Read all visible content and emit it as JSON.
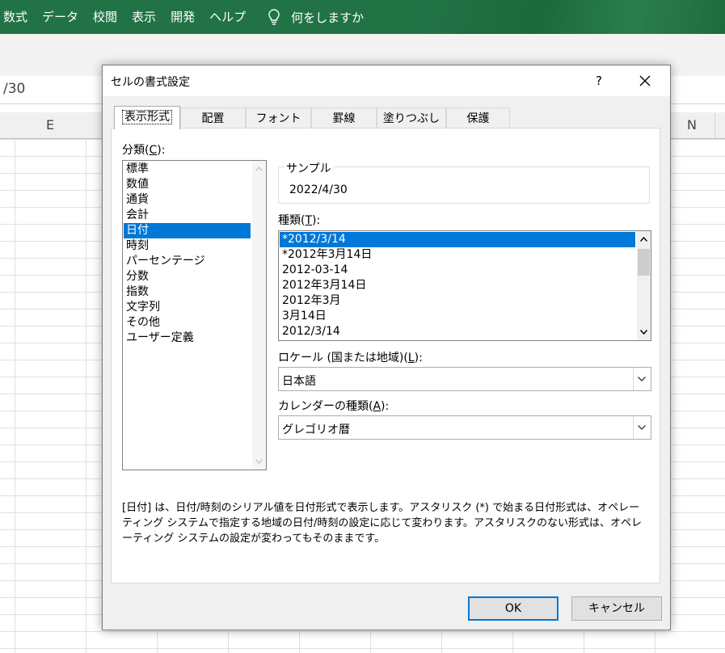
{
  "ribbon": {
    "tabs": [
      "数式",
      "データ",
      "校閲",
      "表示",
      "開発",
      "ヘルプ"
    ],
    "tell_me": "何をしますか"
  },
  "formula_bar": {
    "value": "/30"
  },
  "columns": {
    "left": "E",
    "right": "N"
  },
  "dialog": {
    "title": "セルの書式設定",
    "help": "?",
    "tabs": [
      "表示形式",
      "配置",
      "フォント",
      "罫線",
      "塗りつぶし",
      "保護"
    ],
    "active_tab": "表示形式",
    "category_label": "分類(C):",
    "category_label_parts": {
      "pre": "分類(",
      "key": "C",
      "post": "):"
    },
    "categories": [
      "標準",
      "数値",
      "通貨",
      "会計",
      "日付",
      "時刻",
      "パーセンテージ",
      "分数",
      "指数",
      "文字列",
      "その他",
      "ユーザー定義"
    ],
    "selected_category": "日付",
    "sample_label": "サンプル",
    "sample_value": "2022/4/30",
    "type_label_parts": {
      "pre": "種類(",
      "key": "T",
      "post": "):"
    },
    "types": [
      "*2012/3/14",
      "*2012年3月14日",
      "2012-03-14",
      "2012年3月14日",
      "2012年3月",
      "3月14日",
      "2012/3/14"
    ],
    "selected_type": "*2012/3/14",
    "locale_label_parts": {
      "pre": "ロケール (国または地域)(",
      "key": "L",
      "post": "):"
    },
    "locale_value": "日本語",
    "calendar_label_parts": {
      "pre": "カレンダーの種類(",
      "key": "A",
      "post": "):"
    },
    "calendar_value": "グレゴリオ暦",
    "description": "[日付] は、日付/時刻のシリアル値を日付形式で表示します。アスタリスク (*) で始まる日付形式は、オペレーティング システムで指定する地域の日付/時刻の設定に応じて変わります。アスタリスクのない形式は、オペレーティング システムの設定が変わってもそのままです。",
    "ok_label": "OK",
    "cancel_label": "キャンセル"
  },
  "colors": {
    "ribbon": "#217346",
    "selection": "#0078d7",
    "default_border": "#0078d7"
  },
  "icons": {
    "tell_me": "lightbulb-icon",
    "close": "close-icon",
    "scroll_up": "chevron-up-icon",
    "scroll_down": "chevron-down-icon",
    "dropdown": "chevron-down-icon"
  }
}
